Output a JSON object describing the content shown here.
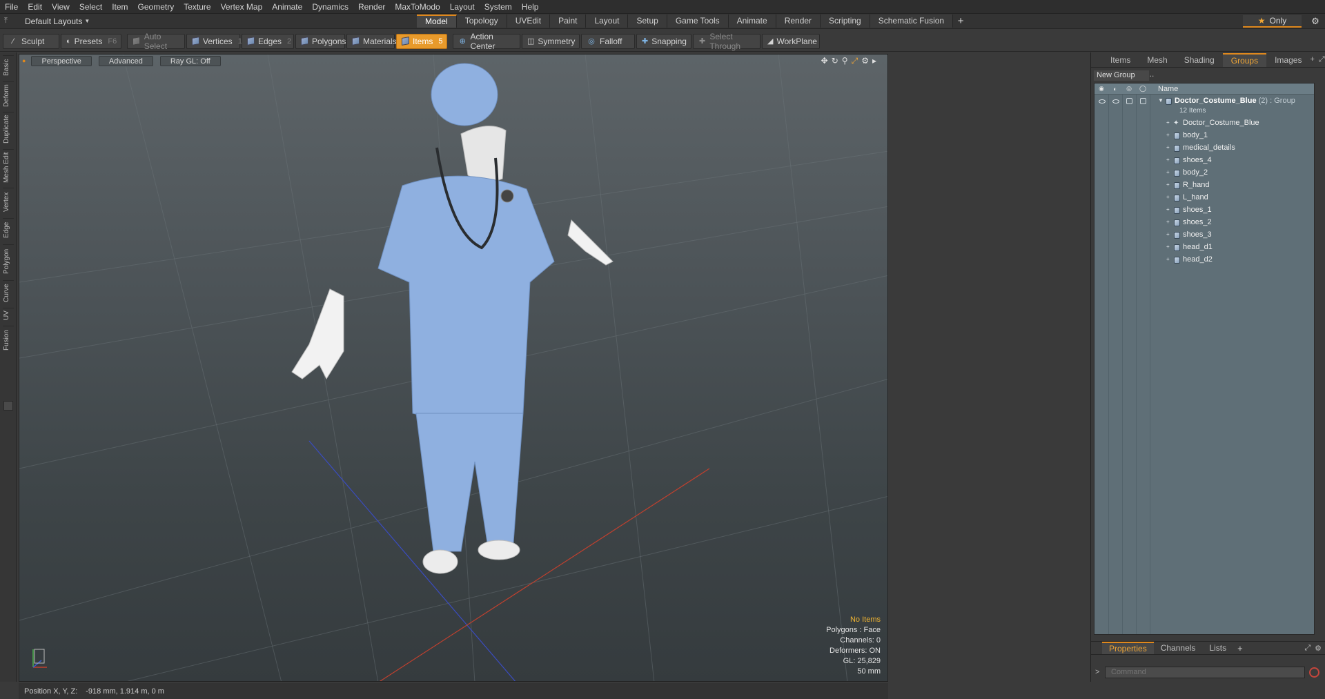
{
  "menu": [
    "File",
    "Edit",
    "View",
    "Select",
    "Item",
    "Geometry",
    "Texture",
    "Vertex Map",
    "Animate",
    "Dynamics",
    "Render",
    "MaxToModo",
    "Layout",
    "System",
    "Help"
  ],
  "layouts": {
    "label": "Default Layouts"
  },
  "tabs": [
    {
      "label": "Model",
      "active": true
    },
    {
      "label": "Topology"
    },
    {
      "label": "UVEdit"
    },
    {
      "label": "Paint"
    },
    {
      "label": "Layout"
    },
    {
      "label": "Setup"
    },
    {
      "label": "Game Tools"
    },
    {
      "label": "Animate"
    },
    {
      "label": "Render"
    },
    {
      "label": "Scripting"
    },
    {
      "label": "Schematic Fusion"
    }
  ],
  "only_button": {
    "label": "Only"
  },
  "toolbar": {
    "sculpt": "Sculpt",
    "presets": "Presets",
    "presets_key": "F6",
    "auto_select": "Auto Select",
    "vertices": "Vertices",
    "vertices_key": "1",
    "edges": "Edges",
    "edges_key": "2",
    "polygons": "Polygons",
    "materials": "Materials",
    "items": "Items",
    "items_key": "5",
    "action_center": "Action Center",
    "symmetry": "Symmetry",
    "falloff": "Falloff",
    "snapping": "Snapping",
    "select_through": "Select Through",
    "workplane": "WorkPlane"
  },
  "left_tabs": [
    "Basic",
    "Deform",
    "Duplicate",
    "Mesh Edit",
    "Vertex",
    "Edge",
    "Polygon",
    "Curve",
    "UV",
    "Fusion"
  ],
  "viewport": {
    "view": "Perspective",
    "shading": "Advanced",
    "raygl": "Ray GL: Off",
    "stats": {
      "no_items": "No Items",
      "polygons": "Polygons : Face",
      "channels": "Channels: 0",
      "deformers": "Deformers: ON",
      "gl": "GL: 25,829",
      "focal": "50 mm"
    }
  },
  "right_tabs": [
    {
      "label": "Items"
    },
    {
      "label": "Mesh ..."
    },
    {
      "label": "Shading"
    },
    {
      "label": "Groups",
      "active": true
    },
    {
      "label": "Images"
    }
  ],
  "groups": {
    "new_group": "New Group",
    "column_name": "Name",
    "group": {
      "name": "Doctor_Costume_Blue",
      "suffix": "(2) : Group",
      "count": "12 Items"
    },
    "items": [
      "Doctor_Costume_Blue",
      "body_1",
      "medical_details",
      "shoes_4",
      "body_2",
      "R_hand",
      "L_hand",
      "shoes_1",
      "shoes_2",
      "shoes_3",
      "head_d1",
      "head_d2"
    ]
  },
  "bottom_tabs": [
    {
      "label": "Properties",
      "active": true
    },
    {
      "label": "Channels"
    },
    {
      "label": "Lists"
    }
  ],
  "command": {
    "placeholder": "Command"
  },
  "status": {
    "label": "Position X, Y, Z:",
    "value": "-918 mm, 1.914 m, 0 m"
  },
  "colors": {
    "accent": "#e0881c",
    "costume": "#8fb0e0",
    "list_bg": "#5f6f77"
  }
}
